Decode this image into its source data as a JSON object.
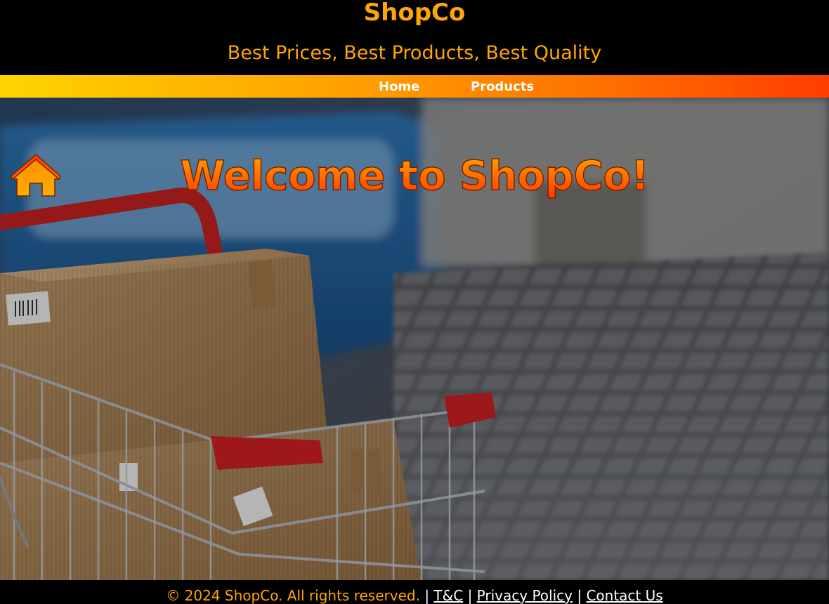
{
  "header": {
    "brand": "ShopCo",
    "tagline": "Best Prices, Best Products, Best Quality"
  },
  "nav": {
    "home_label": "Home",
    "products_label": "Products"
  },
  "hero": {
    "title": "Welcome to ShopCo!",
    "title_icon": "home-icon"
  },
  "footer": {
    "copyright": "© 2024 ShopCo. All rights reserved.",
    "separator": "|",
    "links": {
      "tc": "T&C",
      "privacy": "Privacy Policy",
      "contact": "Contact Us"
    }
  },
  "colors": {
    "brand_orange": "#ffa600",
    "nav_gradient_start": "#ffd400",
    "nav_gradient_end": "#ff3d00",
    "header_bg": "#000000"
  }
}
